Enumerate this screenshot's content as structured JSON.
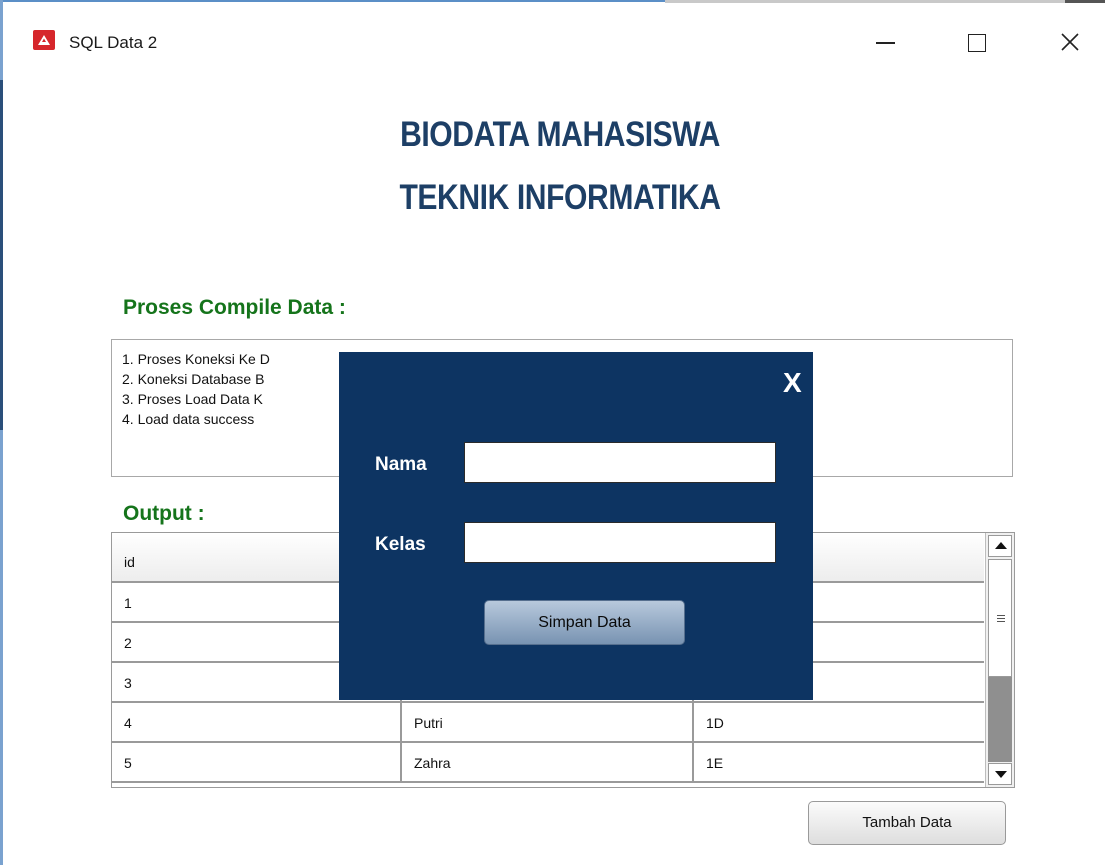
{
  "window": {
    "title": "SQL Data 2",
    "controls": {
      "minimize": "minimize",
      "maximize": "maximize",
      "close": "close"
    }
  },
  "header": {
    "line1": "BIODATA MAHASISWA",
    "line2": "TEKNIK INFORMATIKA"
  },
  "compile": {
    "label": "Proses Compile Data :",
    "log": [
      "1. Proses Koneksi Ke D",
      "2. Koneksi Database B",
      "3. Proses Load Data K",
      "4. Load data success"
    ]
  },
  "output": {
    "label": "Output :",
    "columns": [
      "id",
      "",
      ""
    ],
    "rows": [
      [
        "1",
        "",
        ""
      ],
      [
        "2",
        "",
        ""
      ],
      [
        "3",
        "",
        ""
      ],
      [
        "4",
        "Putri",
        "1D"
      ],
      [
        "5",
        "Zahra",
        "1E"
      ]
    ]
  },
  "actions": {
    "tambah_label": "Tambah Data"
  },
  "modal": {
    "close_label": "X",
    "nama_label": "Nama",
    "kelas_label": "Kelas",
    "nama_value": "",
    "kelas_value": "",
    "simpan_label": "Simpan Data"
  },
  "colors": {
    "heading": "#1d3f66",
    "section_label": "#15741b",
    "modal_bg": "#0d3462",
    "app_icon": "#d6262b"
  },
  "icons": {
    "app": "app-logo-icon",
    "close": "close-icon",
    "scroll_up": "arrow-up-icon",
    "scroll_down": "arrow-down-icon"
  }
}
